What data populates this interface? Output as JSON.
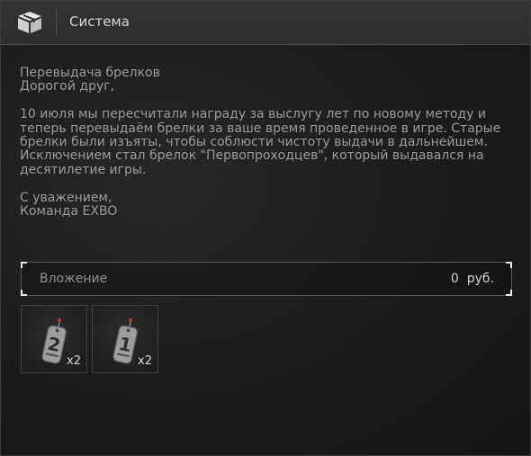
{
  "header": {
    "title": "Система",
    "icon": "box-icon"
  },
  "message": {
    "subject": "Перевыдача брелков",
    "greeting": "Дорогой друг,",
    "paragraph_lines": [
      "10 июля мы пересчитали награду за выслугу лет по новому методу и",
      "теперь перевыдаём брелки за ваше время проведенное в игре. Старые",
      "брелки были изъяты, чтобы соблюсти чистоту выдачи в дальнейшем.",
      "Исключением стал брелок \"Первопроходцев\", который выдавался на",
      "десятилетие игры."
    ],
    "signoff": "С уважением,",
    "signature": "Команда EXBO"
  },
  "attachment": {
    "label": "Вложение",
    "amount": "0  руб."
  },
  "items": [
    {
      "icon": "keychain-tag-2-icon",
      "glyph": "2",
      "count": "x2"
    },
    {
      "icon": "keychain-tag-1-icon",
      "glyph": "1",
      "count": "x2"
    }
  ],
  "colors": {
    "background": "#1c1e1d",
    "header": "#2f3130",
    "text": "#9a9c9b",
    "title": "#d6d6d6",
    "tag_accent": "#c0392b"
  }
}
